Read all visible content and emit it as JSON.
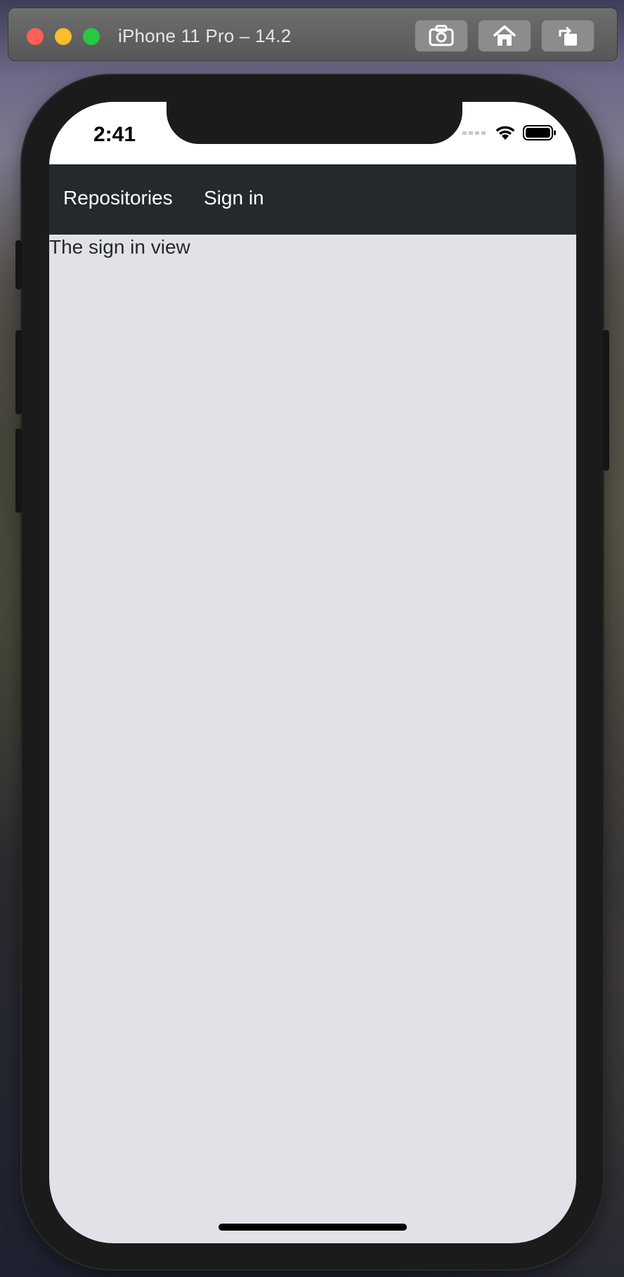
{
  "simulator": {
    "title": "iPhone 11 Pro – 14.2",
    "toolbar": {
      "screenshot_icon": "camera-icon",
      "home_icon": "home-icon",
      "rotate_icon": "rotate-icon"
    }
  },
  "statusbar": {
    "time": "2:41"
  },
  "navbar": {
    "links": [
      "Repositories",
      "Sign in"
    ],
    "background": "#24292e"
  },
  "main": {
    "text": "The sign in view",
    "background": "#e0e2e7"
  }
}
